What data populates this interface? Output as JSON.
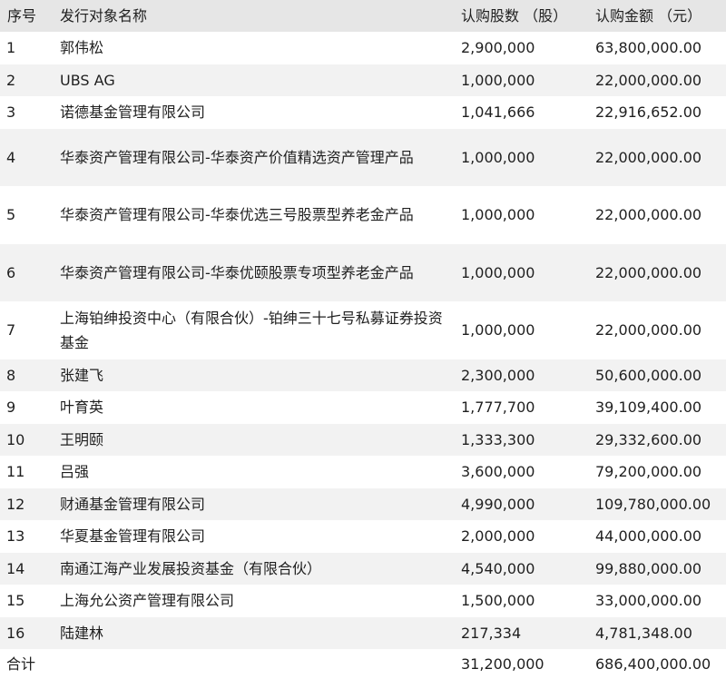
{
  "table": {
    "headers": {
      "index": "序号",
      "name": "发行对象名称",
      "shares": "认购股数 （股）",
      "amount": "认购金额 （元）"
    },
    "rows": [
      {
        "index": "1",
        "name": "郭伟松",
        "shares": "2,900,000",
        "amount": "63,800,000.00"
      },
      {
        "index": "2",
        "name": "UBS AG",
        "shares": "1,000,000",
        "amount": "22,000,000.00"
      },
      {
        "index": "3",
        "name": "诺德基金管理有限公司",
        "shares": "1,041,666",
        "amount": "22,916,652.00"
      },
      {
        "index": "4",
        "name": "华泰资产管理有限公司-华泰资产价值精选资产管理产品",
        "shares": "1,000,000",
        "amount": "22,000,000.00"
      },
      {
        "index": "5",
        "name": "华泰资产管理有限公司-华泰优选三号股票型养老金产品",
        "shares": "1,000,000",
        "amount": "22,000,000.00"
      },
      {
        "index": "6",
        "name": "华泰资产管理有限公司-华泰优颐股票专项型养老金产品",
        "shares": "1,000,000",
        "amount": "22,000,000.00"
      },
      {
        "index": "7",
        "name": "上海铂绅投资中心（有限合伙）-铂绅三十七号私募证券投资基金",
        "shares": "1,000,000",
        "amount": "22,000,000.00"
      },
      {
        "index": "8",
        "name": "张建飞",
        "shares": "2,300,000",
        "amount": "50,600,000.00"
      },
      {
        "index": "9",
        "name": "叶育英",
        "shares": "1,777,700",
        "amount": "39,109,400.00"
      },
      {
        "index": "10",
        "name": "王明颐",
        "shares": "1,333,300",
        "amount": "29,332,600.00"
      },
      {
        "index": "11",
        "name": "吕强",
        "shares": "3,600,000",
        "amount": "79,200,000.00"
      },
      {
        "index": "12",
        "name": "财通基金管理有限公司",
        "shares": "4,990,000",
        "amount": "109,780,000.00"
      },
      {
        "index": "13",
        "name": "华夏基金管理有限公司",
        "shares": "2,000,000",
        "amount": "44,000,000.00"
      },
      {
        "index": "14",
        "name": "南通江海产业发展投资基金（有限合伙）",
        "shares": "4,540,000",
        "amount": "99,880,000.00"
      },
      {
        "index": "15",
        "name": "上海允公资产管理有限公司",
        "shares": "1,500,000",
        "amount": "33,000,000.00"
      },
      {
        "index": "16",
        "name": "陆建林",
        "shares": "217,334",
        "amount": "4,781,348.00"
      }
    ],
    "total": {
      "label": "合计",
      "shares": "31,200,000",
      "amount": "686,400,000.00"
    }
  }
}
